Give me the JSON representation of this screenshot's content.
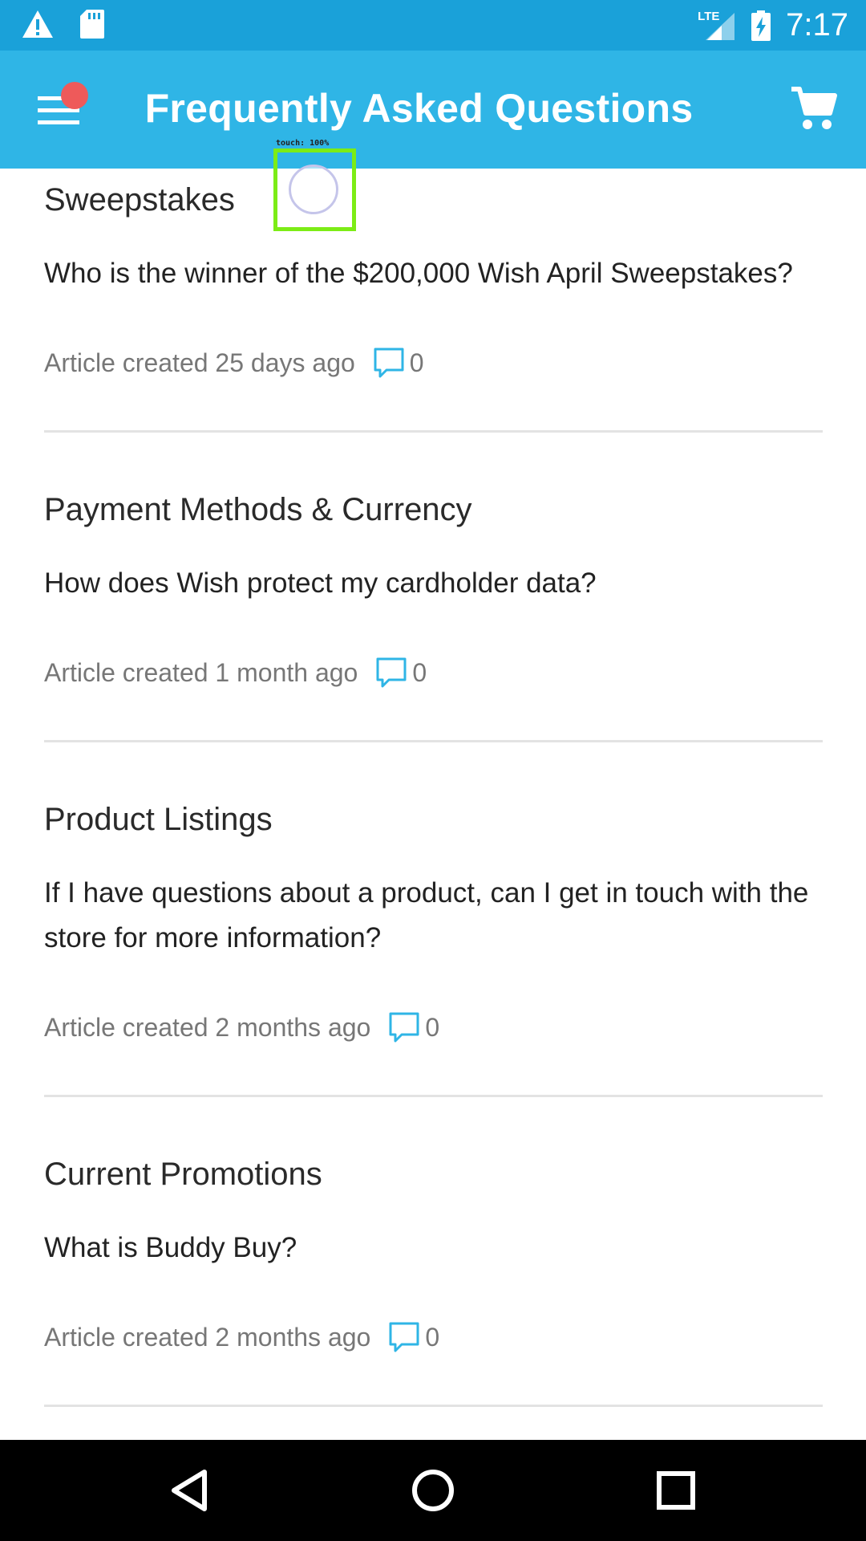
{
  "status_bar": {
    "time": "7:17",
    "network": "LTE",
    "icons": [
      "warning-icon",
      "sd-card-icon",
      "signal-icon",
      "battery-charging-icon"
    ]
  },
  "app_bar": {
    "title": "Frequently Asked Questions",
    "menu_icon": "menu-icon",
    "cart_icon": "cart-icon"
  },
  "touch_indicator": {
    "label": "touch: 100%"
  },
  "articles": [
    {
      "category": "Sweepstakes",
      "question": "Who is the winner of the $200,000 Wish April Sweepstakes?",
      "meta": "Article created 25 days ago",
      "comments": "0"
    },
    {
      "category": "Payment Methods & Currency",
      "question": "How does Wish protect my cardholder data?",
      "meta": "Article created 1 month ago",
      "comments": "0"
    },
    {
      "category": "Product Listings",
      "question": "If I have questions about a product, can I get in touch with the store for more information?",
      "meta": "Article created 2 months ago",
      "comments": "0"
    },
    {
      "category": "Current Promotions",
      "question": "What is Buddy Buy?",
      "meta": "Article created 2 months ago",
      "comments": "0"
    }
  ],
  "colors": {
    "status_bar": "#1aa1d9",
    "app_bar": "#2fb5e6",
    "accent_icon": "#2fb5e6",
    "notification_dot": "#ee5a5a"
  }
}
